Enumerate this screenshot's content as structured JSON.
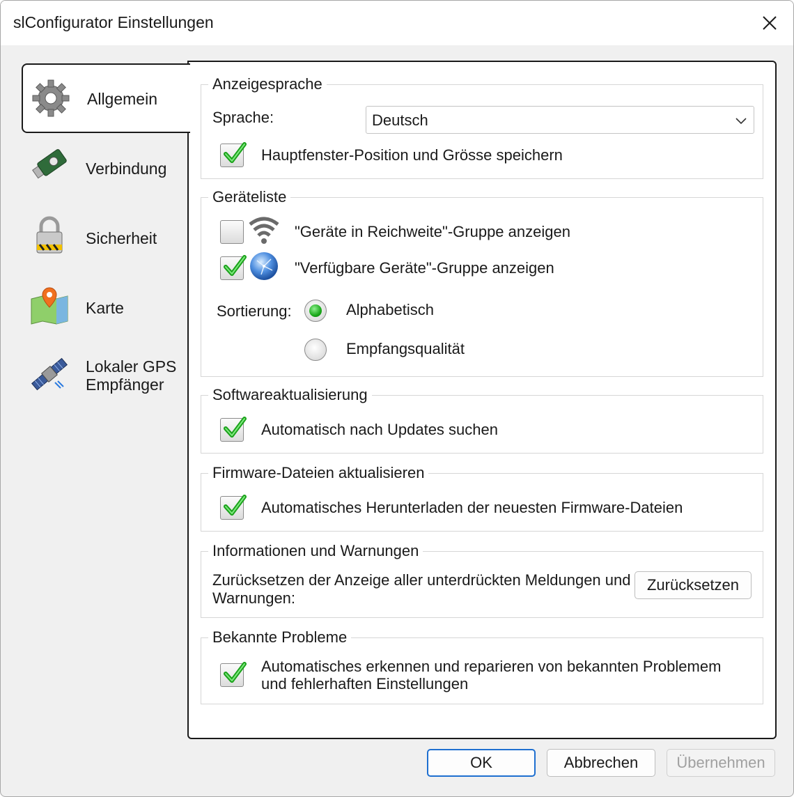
{
  "window": {
    "title": "slConfigurator Einstellungen"
  },
  "tabs": [
    {
      "id": "allgemein",
      "label": "Allgemein",
      "icon": "gear-icon",
      "active": true
    },
    {
      "id": "verbindung",
      "label": "Verbindung",
      "icon": "usb-stick-icon"
    },
    {
      "id": "sicherheit",
      "label": "Sicherheit",
      "icon": "padlock-icon"
    },
    {
      "id": "karte",
      "label": "Karte",
      "icon": "map-pin-icon"
    },
    {
      "id": "gps",
      "label_line1": "Lokaler GPS",
      "label_line2": "Empfänger",
      "icon": "satellite-icon"
    }
  ],
  "anzeigesprache": {
    "legend": "Anzeigesprache",
    "sprache_label": "Sprache:",
    "sprache_value": "Deutsch",
    "save_position_label": "Hauptfenster-Position und Grösse speichern",
    "save_position_checked": true
  },
  "geraeteliste": {
    "legend": "Geräteliste",
    "in_range_label": "\"Geräte in Reichweite\"-Gruppe anzeigen",
    "in_range_checked": false,
    "available_label": "\"Verfügbare Geräte\"-Gruppe anzeigen",
    "available_checked": true,
    "sort_label": "Sortierung:",
    "sort_alpha": "Alphabetisch",
    "sort_quality": "Empfangsqualität",
    "sort_selected": "alpha"
  },
  "software": {
    "legend": "Softwareaktualisierung",
    "auto_update_label": "Automatisch nach Updates suchen",
    "auto_update_checked": true
  },
  "firmware": {
    "legend": "Firmware-Dateien aktualisieren",
    "auto_download_label": "Automatisches Herunterladen der neuesten Firmware-Dateien",
    "auto_download_checked": true
  },
  "info": {
    "legend": "Informationen und Warnungen",
    "reset_text_line1": "Zurücksetzen der Anzeige aller unterdrückten Meldungen und",
    "reset_text_line2": "Warnungen:",
    "reset_button": "Zurücksetzen"
  },
  "probleme": {
    "legend": "Bekannte Probleme",
    "auto_fix_line1": "Automatisches erkennen und reparieren von bekannten Problemem",
    "auto_fix_line2": "und fehlerhaften Einstellungen",
    "auto_fix_checked": true
  },
  "footer": {
    "ok": "OK",
    "cancel": "Abbrechen",
    "apply": "Übernehmen"
  }
}
